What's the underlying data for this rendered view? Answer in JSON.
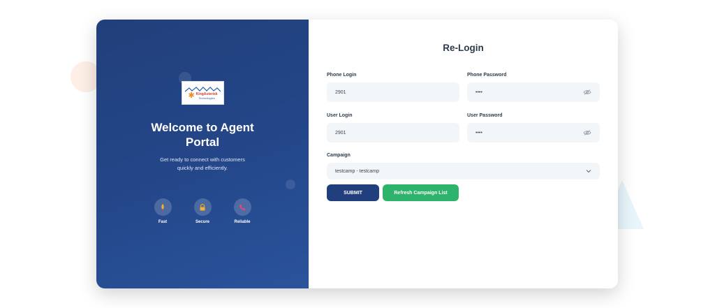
{
  "brand": {
    "logo_text": "KingAsterisk",
    "logo_subtext": "Technologies"
  },
  "welcome": {
    "title_line1": "Welcome to Agent",
    "title_line2": "Portal",
    "subtitle_line1": "Get ready to connect with customers",
    "subtitle_line2": "quickly and efficiently."
  },
  "features": [
    {
      "label": "Fast",
      "icon": "rocket-icon"
    },
    {
      "label": "Secure",
      "icon": "lock-icon"
    },
    {
      "label": "Reliable",
      "icon": "phone-icon"
    }
  ],
  "form": {
    "title": "Re-Login",
    "phone_login": {
      "label": "Phone Login",
      "value": "2901"
    },
    "phone_password": {
      "label": "Phone Password",
      "value": "••••"
    },
    "user_login": {
      "label": "User Login",
      "value": "2901"
    },
    "user_password": {
      "label": "User Password",
      "value": "••••"
    },
    "campaign": {
      "label": "Campaign",
      "selected": "testcamp - testcamp"
    },
    "submit_label": "SUBMIT",
    "refresh_label": "Refresh Campaign List"
  },
  "colors": {
    "panel_dark": "#213f7a",
    "submit": "#203f7c",
    "refresh": "#2db36b",
    "field_bg": "#f3f6f9"
  }
}
